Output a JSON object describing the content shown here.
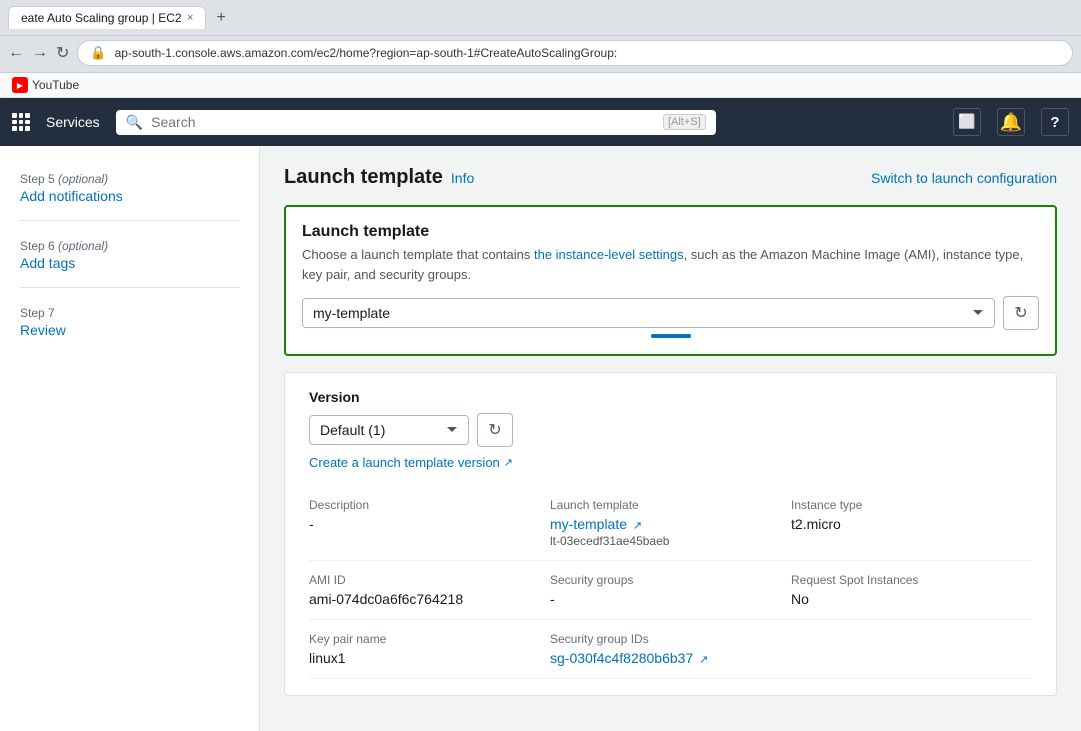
{
  "browser": {
    "tab_title": "eate Auto Scaling group | EC2",
    "tab_close": "×",
    "tab_add": "+",
    "url": "ap-south-1.console.aws.amazon.com/ec2/home?region=ap-south-1#CreateAutoScalingGroup:",
    "nav_back": "←",
    "nav_forward": "→",
    "nav_refresh": "↻"
  },
  "bookmarks": [
    {
      "label": "YouTube",
      "type": "youtube"
    }
  ],
  "topnav": {
    "services_label": "Services",
    "search_placeholder": "Search",
    "search_shortcut": "[Alt+S]",
    "icon_apps": "⊞",
    "icon_bell": "🔔",
    "icon_help": "?"
  },
  "sidebar": {
    "steps": [
      {
        "id": "step5",
        "number": "Step 5",
        "optional": true,
        "link": "Add notifications"
      },
      {
        "id": "step6",
        "number": "Step 6",
        "optional": true,
        "link": "Add tags"
      },
      {
        "id": "step7",
        "number": "Step 7",
        "optional": false,
        "link": "Review"
      }
    ]
  },
  "main": {
    "section_title": "Launch template",
    "info_label": "Info",
    "switch_link": "Switch to launch configuration",
    "lt_box": {
      "title": "Launch template",
      "description_start": "Choose a launch template that contains the instance-level settings, such as the Amazon Machine Image (AMI), instance type, key pair, and security groups.",
      "description_link_text": "the instance-level settings",
      "dropdown_value": "my-template",
      "dropdown_options": [
        "my-template"
      ]
    },
    "version": {
      "label": "Version",
      "dropdown_value": "Default (1)",
      "dropdown_options": [
        "Default (1)"
      ]
    },
    "create_lt_link": "Create a launch template version",
    "details": {
      "description_label": "Description",
      "description_value": "-",
      "lt_label": "Launch template",
      "lt_name": "my-template",
      "lt_id": "lt-03ecedf31ae45baeb",
      "instance_type_label": "Instance type",
      "instance_type_value": "t2.micro",
      "ami_id_label": "AMI ID",
      "ami_id_value": "ami-074dc0a6f6c764218",
      "security_groups_label": "Security groups",
      "security_groups_value": "-",
      "request_spot_label": "Request Spot Instances",
      "request_spot_value": "No",
      "key_pair_label": "Key pair name",
      "key_pair_value": "linux1",
      "sg_ids_label": "Security group IDs",
      "sg_ids_value": "sg-030f4c4f8280b6b37"
    }
  }
}
